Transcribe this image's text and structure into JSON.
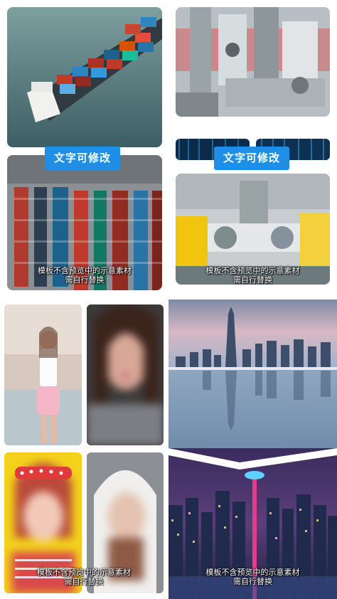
{
  "badges": {
    "left": "文字可修改",
    "right": "文字可修改"
  },
  "captions": {
    "top_left": {
      "line1": "模板不含预览中的示意素材",
      "line2": "需自行替换"
    },
    "top_right": {
      "line1": "模板不含预览中的示意素材",
      "line2": "需自行替换"
    },
    "bottom_left": {
      "line1": "模板不含预览中的示意素材",
      "line2": "需自行替换"
    },
    "bottom_right": {
      "line1": "模板不含预览中的示意素材",
      "line2": "需自行替换"
    }
  },
  "colors": {
    "badge_blue": "#1e8ee6",
    "background": "#ffffff"
  }
}
